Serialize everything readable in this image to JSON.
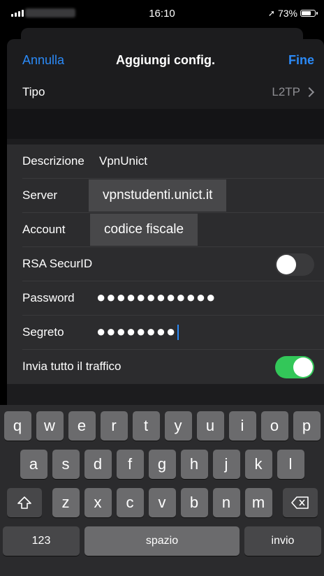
{
  "status_bar": {
    "time": "16:10",
    "battery": "73%",
    "battery_level": 0.73
  },
  "nav": {
    "cancel": "Annulla",
    "title": "Aggiungi config.",
    "done": "Fine"
  },
  "type_row": {
    "label": "Tipo",
    "value": "L2TP"
  },
  "form": {
    "description": {
      "label": "Descrizione",
      "value": "VpnUnict"
    },
    "server": {
      "label": "Server",
      "value": "vpnstudenti.unict.it"
    },
    "account": {
      "label": "Account",
      "value": "codice fiscale"
    },
    "rsa": {
      "label": "RSA SecurID",
      "on": false
    },
    "password": {
      "label": "Password",
      "value": "●●●●●●●●●●●●"
    },
    "secret": {
      "label": "Segreto",
      "value": "●●●●●●●●"
    },
    "send_all": {
      "label": "Invia tutto il traffico",
      "on": true
    }
  },
  "keyboard": {
    "row1": [
      "q",
      "w",
      "e",
      "r",
      "t",
      "y",
      "u",
      "i",
      "o",
      "p"
    ],
    "row2": [
      "a",
      "s",
      "d",
      "f",
      "g",
      "h",
      "j",
      "k",
      "l"
    ],
    "row3": [
      "z",
      "x",
      "c",
      "v",
      "b",
      "n",
      "m"
    ],
    "k123": "123",
    "space": "spazio",
    "return": "invio"
  }
}
